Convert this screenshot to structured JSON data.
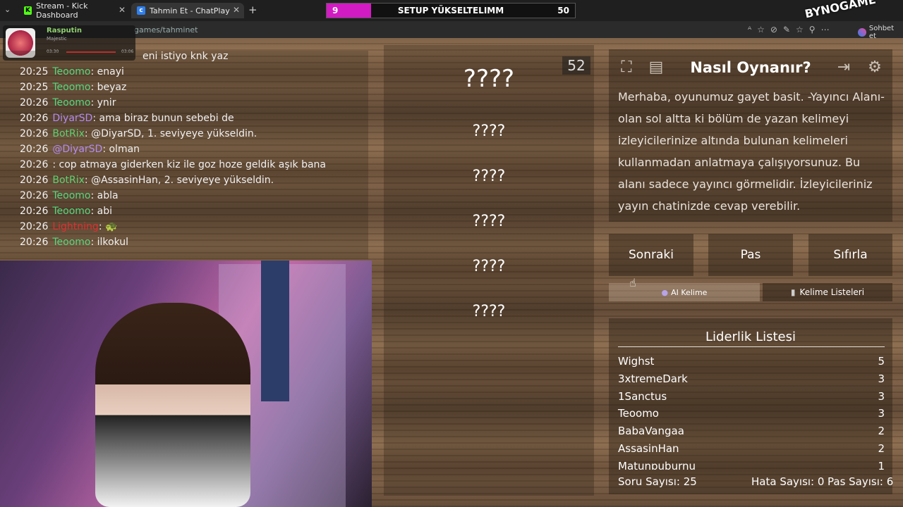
{
  "browser": {
    "tabs": [
      {
        "label": "Stream - Kick Dashboard",
        "icon": "kick-icon"
      },
      {
        "label": "Tahmin Et - ChatPlay",
        "icon": "chatplay-icon"
      }
    ],
    "url": "games/tahminet",
    "right_label": "Sohbet et"
  },
  "goal_bar": {
    "left": "9",
    "label": "SETUP YÜKSELTELIMM",
    "right": "50",
    "progress": 0.18
  },
  "overlay_brand": "BYNOGAME",
  "music": {
    "user": "Rasputin",
    "track": "Majestic",
    "time_start": "03:30",
    "time_end": "03:06"
  },
  "chat": {
    "lines": [
      {
        "time": "",
        "user": "",
        "text": "eni istiyo knk yaz",
        "color": "#ffffff"
      },
      {
        "time": "20:25",
        "user": "Teoomo",
        "text": ": enayi",
        "color": "#56d77d"
      },
      {
        "time": "20:25",
        "user": "Teoomo",
        "text": ": beyaz",
        "color": "#56d77d"
      },
      {
        "time": "20:26",
        "user": "Teoomo",
        "text": ": ynir",
        "color": "#56d77d"
      },
      {
        "time": "20:26",
        "user": "DiyarSD",
        "text": ": ama biraz bunun sebebi de",
        "color": "#b48cf0"
      },
      {
        "time": "20:26",
        "user": "BotRix",
        "text": ": @DiyarSD, 1. seviyeye yükseldin.",
        "color": "#5fd070"
      },
      {
        "time": "20:26",
        "user": "@DiyarSD",
        "text": ": olman",
        "color": "#b48cf0"
      },
      {
        "time": "20:26",
        "user": "",
        "text": ": cop atmaya giderken kiz ile goz hoze geldik aşık bana",
        "color": "#f05050"
      },
      {
        "time": "20:26",
        "user": "BotRix",
        "text": ": @AssasinHan, 2. seviyeye yükseldin.",
        "color": "#5fd070"
      },
      {
        "time": "20:26",
        "user": "Teoomo",
        "text": ": abla",
        "color": "#56d77d"
      },
      {
        "time": "20:26",
        "user": "Teoomo",
        "text": ": abi",
        "color": "#56d77d"
      },
      {
        "time": "20:26",
        "user": "Lightning",
        "text": ": 🐢",
        "color": "#e03030"
      },
      {
        "time": "20:26",
        "user": "Teoomo",
        "text": ": ilkokul",
        "color": "#56d77d"
      }
    ]
  },
  "game": {
    "count": "52",
    "questions": [
      "????",
      "????",
      "????",
      "????",
      "????",
      "????"
    ],
    "howto_title": "Nasıl Oynanır?",
    "howto_text": "Merhaba, oyunumuz gayet basit. -Yayıncı Alanı- olan sol altta ki bölüm de yazan kelimeyi izleyicilerinize altında bulunan kelimeleri kullanmadan anlatmaya çalışıyorsunuz. Bu alanı sadece yayıncı görmelidir. İzleyicileriniz yayın chatinizde cevap verebilir.",
    "buttons": {
      "next": "Sonraki",
      "pass": "Pas",
      "reset": "Sıfırla"
    },
    "ai_word": "AI Kelime",
    "word_lists": "Kelime Listeleri",
    "leaderboard_title": "Liderlik Listesi",
    "leaderboard": [
      {
        "name": "Wighst",
        "score": "5"
      },
      {
        "name": "3xtremeDark",
        "score": "3"
      },
      {
        "name": "1Sanctus",
        "score": "3"
      },
      {
        "name": "Teoomo",
        "score": "3"
      },
      {
        "name": "BabaVangaa",
        "score": "2"
      },
      {
        "name": "AssasinHan",
        "score": "2"
      },
      {
        "name": "Matunpuburnu",
        "score": "1"
      }
    ],
    "stats": {
      "questions": "Soru Sayısı: 25",
      "errors": "Hata Sayısı: 0",
      "passes": "Pas Sayısı: 6"
    }
  }
}
